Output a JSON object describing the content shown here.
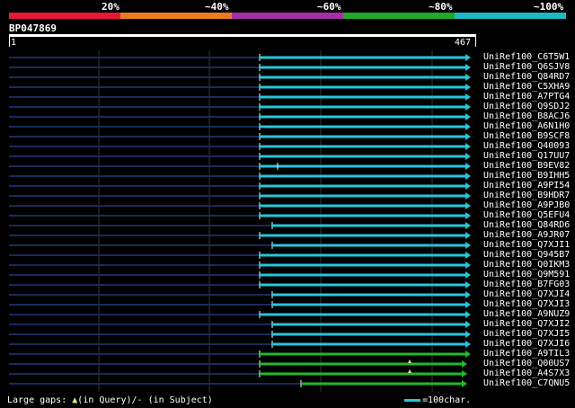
{
  "header": {
    "percent_labels": [
      "20%",
      "~40%",
      "~60%",
      "~80%",
      "~100%"
    ],
    "legend_colors": [
      "#e8173a",
      "#e87d1e",
      "#a52fa5",
      "#22a82a",
      "#20b8c2"
    ],
    "query_id": "BP047869",
    "ruler_start": "1",
    "ruler_end": "467"
  },
  "hits": [
    {
      "label": "UniRef100_C6T5W1",
      "start": 289,
      "end": 524,
      "color": "#26c6da",
      "arrow": true
    },
    {
      "label": "UniRef100_Q6SJV8",
      "start": 289,
      "end": 524,
      "color": "#26c6da",
      "arrow": true
    },
    {
      "label": "UniRef100_Q84RD7",
      "start": 289,
      "end": 524,
      "color": "#26c6da",
      "arrow": true
    },
    {
      "label": "UniRef100_C5XHA9",
      "start": 289,
      "end": 524,
      "color": "#26c6da",
      "arrow": true
    },
    {
      "label": "UniRef100_A7PTG4",
      "start": 289,
      "end": 524,
      "color": "#26c6da",
      "arrow": true
    },
    {
      "label": "UniRef100_Q9SDJ2",
      "start": 289,
      "end": 524,
      "color": "#26c6da",
      "arrow": true
    },
    {
      "label": "UniRef100_B8ACJ6",
      "start": 289,
      "end": 524,
      "color": "#26c6da",
      "arrow": true
    },
    {
      "label": "UniRef100_A6N1H0",
      "start": 289,
      "end": 524,
      "color": "#26c6da",
      "arrow": true
    },
    {
      "label": "UniRef100_B9SCF8",
      "start": 289,
      "end": 524,
      "color": "#26c6da",
      "arrow": true
    },
    {
      "label": "UniRef100_Q40093",
      "start": 289,
      "end": 524,
      "color": "#26c6da",
      "arrow": true
    },
    {
      "label": "UniRef100_Q17UU7",
      "start": 289,
      "end": 524,
      "color": "#26c6da",
      "arrow": true
    },
    {
      "label": "UniRef100_B9EV82",
      "start": 289,
      "end": 524,
      "color": "#26c6da",
      "arrow": true,
      "gap": 309
    },
    {
      "label": "UniRef100_B9IHH5",
      "start": 289,
      "end": 524,
      "color": "#26c6da",
      "arrow": true
    },
    {
      "label": "UniRef100_A9PI54",
      "start": 289,
      "end": 524,
      "color": "#26c6da",
      "arrow": true
    },
    {
      "label": "UniRef100_B9HDR7",
      "start": 289,
      "end": 524,
      "color": "#26c6da",
      "arrow": true
    },
    {
      "label": "UniRef100_A9PJB0",
      "start": 289,
      "end": 524,
      "color": "#26c6da",
      "arrow": true
    },
    {
      "label": "UniRef100_Q5EFU4",
      "start": 289,
      "end": 524,
      "color": "#26c6da",
      "arrow": true
    },
    {
      "label": "UniRef100_Q84RD6",
      "start": 303,
      "end": 524,
      "color": "#26c6da",
      "arrow": true
    },
    {
      "label": "UniRef100_A9JR07",
      "start": 289,
      "end": 524,
      "color": "#26c6da",
      "arrow": true
    },
    {
      "label": "UniRef100_Q7XJI1",
      "start": 303,
      "end": 524,
      "color": "#26c6da",
      "arrow": true
    },
    {
      "label": "UniRef100_Q945B7",
      "start": 289,
      "end": 524,
      "color": "#26c6da",
      "arrow": true
    },
    {
      "label": "UniRef100_Q0IKM3",
      "start": 289,
      "end": 524,
      "color": "#26c6da",
      "arrow": true
    },
    {
      "label": "UniRef100_Q9M591",
      "start": 289,
      "end": 524,
      "color": "#26c6da",
      "arrow": true
    },
    {
      "label": "UniRef100_B7FG03",
      "start": 289,
      "end": 524,
      "color": "#26c6da",
      "arrow": true
    },
    {
      "label": "UniRef100_Q7XJI4",
      "start": 303,
      "end": 524,
      "color": "#26c6da",
      "arrow": true
    },
    {
      "label": "UniRef100_Q7XJI3",
      "start": 303,
      "end": 524,
      "color": "#26c6da",
      "arrow": true
    },
    {
      "label": "UniRef100_A9NUZ9",
      "start": 289,
      "end": 524,
      "color": "#26c6da",
      "arrow": true
    },
    {
      "label": "UniRef100_Q7XJI2",
      "start": 303,
      "end": 524,
      "color": "#26c6da",
      "arrow": true
    },
    {
      "label": "UniRef100_Q7XJI5",
      "start": 303,
      "end": 524,
      "color": "#26c6da",
      "arrow": true
    },
    {
      "label": "UniRef100_Q7XJI6",
      "start": 303,
      "end": 524,
      "color": "#26c6da",
      "arrow": true
    },
    {
      "label": "UniRef100_A9TIL3",
      "start": 289,
      "end": 524,
      "color": "#22b82a",
      "arrow": true
    },
    {
      "label": "UniRef100_Q00US7",
      "start": 289,
      "end": 520,
      "color": "#22b82a",
      "arrow": true,
      "query_gap": 456
    },
    {
      "label": "UniRef100_A4S7X3",
      "start": 289,
      "end": 520,
      "color": "#22b82a",
      "arrow": true,
      "query_gap": 456
    },
    {
      "label": "UniRef100_C7QNU5",
      "start": 335,
      "end": 520,
      "color": "#22b82a",
      "arrow": true
    }
  ],
  "footer": {
    "large_gaps_prefix": "Large gaps:",
    "query_gap_text": "(in Query)/",
    "subject_gap_text": "- (in Subject)",
    "scale_text": "=100char."
  }
}
